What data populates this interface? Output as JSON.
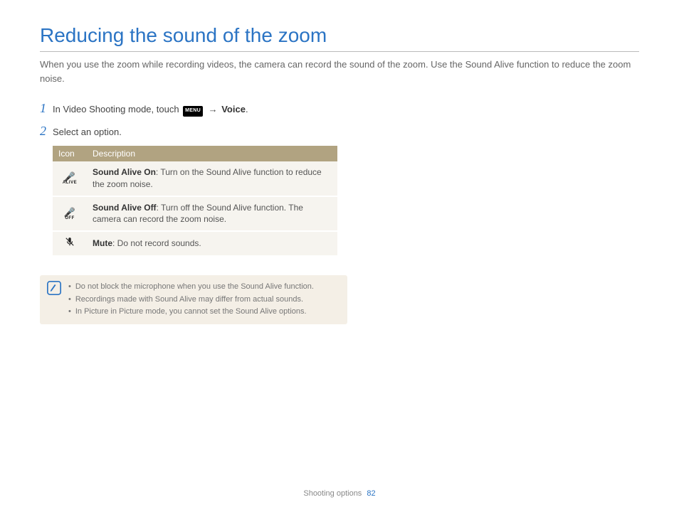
{
  "title": "Reducing the sound of the zoom",
  "intro": "When you use the zoom while recording videos, the camera can record the sound of the zoom. Use the Sound Alive function to reduce the zoom noise.",
  "steps": {
    "s1_num": "1",
    "s1_pre": "In Video Shooting mode, touch ",
    "s1_menu": "MENU",
    "s1_arrow": " → ",
    "s1_voice": "Voice",
    "s1_period": ".",
    "s2_num": "2",
    "s2_text": "Select an option."
  },
  "table": {
    "h_icon": "Icon",
    "h_desc": "Description",
    "rows": [
      {
        "icon_sub": "ALIVE",
        "title": "Sound Alive On",
        "desc": ": Turn on the Sound Alive function to reduce the zoom noise."
      },
      {
        "icon_sub": "OFF",
        "title": "Sound Alive Off",
        "desc": ": Turn off the Sound Alive function. The camera can record the zoom noise."
      },
      {
        "icon_sub": "",
        "title": "Mute",
        "desc": ": Do not record sounds."
      }
    ]
  },
  "notes": [
    "Do not block the microphone when you use the Sound Alive function.",
    "Recordings made with Sound Alive may differ from actual sounds.",
    "In Picture in Picture mode, you cannot set the Sound Alive options."
  ],
  "footer": {
    "section": "Shooting options",
    "page": "82"
  }
}
